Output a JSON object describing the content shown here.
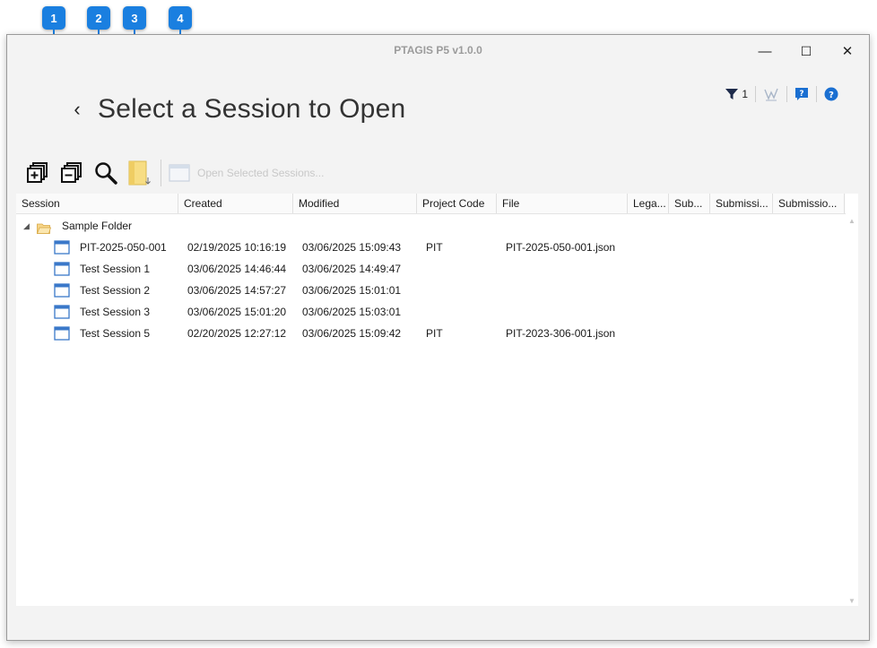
{
  "callouts": [
    "1",
    "2",
    "3",
    "4"
  ],
  "window": {
    "title": "PTAGIS P5 v1.0.0",
    "controls": {
      "minimize": "—",
      "maximize": "☐",
      "close": "✕"
    }
  },
  "topbar": {
    "filter_count": "1"
  },
  "page": {
    "title": "Select a Session to Open"
  },
  "toolbar": {
    "open_selected_label": "Open Selected Sessions..."
  },
  "grid": {
    "columns": [
      "Session",
      "Created",
      "Modified",
      "Project Code",
      "File",
      "Lega...",
      "Sub...",
      "Submissi...",
      "Submissio..."
    ],
    "folder": {
      "name": "Sample Folder"
    },
    "rows": [
      {
        "session": "PIT-2025-050-001",
        "created": "02/19/2025 10:16:19",
        "modified": "03/06/2025 15:09:43",
        "project_code": "PIT",
        "file": "PIT-2025-050-001.json"
      },
      {
        "session": "Test Session 1",
        "created": "03/06/2025 14:46:44",
        "modified": "03/06/2025 14:49:47",
        "project_code": "",
        "file": ""
      },
      {
        "session": "Test Session 2",
        "created": "03/06/2025 14:57:27",
        "modified": "03/06/2025 15:01:01",
        "project_code": "",
        "file": ""
      },
      {
        "session": "Test Session 3",
        "created": "03/06/2025 15:01:20",
        "modified": "03/06/2025 15:03:01",
        "project_code": "",
        "file": ""
      },
      {
        "session": "Test Session 5",
        "created": "02/20/2025 12:27:12",
        "modified": "03/06/2025 15:09:42",
        "project_code": "PIT",
        "file": "PIT-2023-306-001.json"
      }
    ]
  },
  "colors": {
    "accent": "#1a7fe0",
    "folder": "#f2c46b",
    "session_icon": "#3a78c9"
  }
}
